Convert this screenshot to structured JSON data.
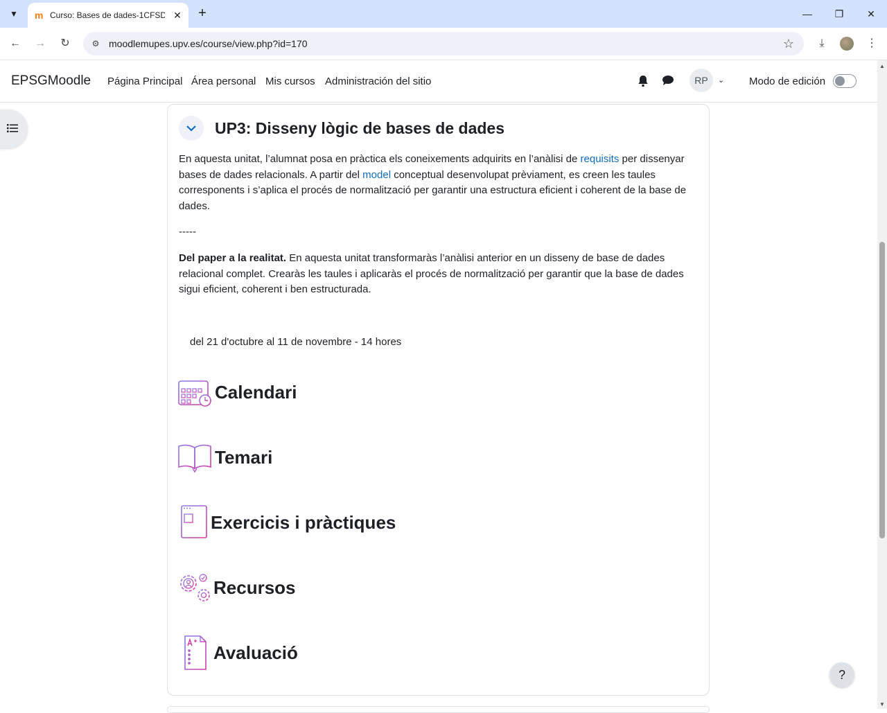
{
  "browser": {
    "tab_title": "Curso: Bases de dades-1CFSDA",
    "favicon": "m",
    "url": "moodlemupes.upv.es/course/view.php?id=170"
  },
  "navbar": {
    "brand": "EPSGMoodle",
    "links": [
      "Página Principal",
      "Área personal",
      "Mis cursos",
      "Administración del sitio"
    ],
    "avatar_initials": "RP",
    "edit_mode_label": "Modo de edición",
    "edit_mode_on": false
  },
  "section": {
    "title": "UP3: Disseny lògic de bases de dades",
    "p1_before_link1": "En aquesta unitat, l’alumnat posa en pràctica els coneixements adquirits en l’anàlisi de ",
    "p1_link1": "requisits",
    "p1_mid": " per dissenyar bases de dades relacionals. A partir del ",
    "p1_link2": "model",
    "p1_after": " conceptual desenvolupat prèviament, es creen les taules corresponents i s’aplica el procés de normalització per garantir una estructura eficient i coherent de la base de dades.",
    "separator": "-----",
    "p2_bold": "Del paper a la realitat.",
    "p2_text": " En aquesta unitat transformaràs l’anàlisi anterior en un disseny de base de dades relacional complet. Crearàs les taules i aplicaràs el procés de normalització per garantir que la base de dades sigui eficient, coherent i ben estructurada.",
    "dates": "del 21 d'octubre al 11 de novembre - 14 hores",
    "blocks": [
      {
        "title": "Calendari",
        "icon": "calendar-clock-icon"
      },
      {
        "title": "Temari",
        "icon": "open-book-icon"
      },
      {
        "title": "Exercicis i pràctiques",
        "icon": "web-page-icon"
      },
      {
        "title": "Recursos",
        "icon": "gears-person-icon"
      },
      {
        "title": "Avaluació",
        "icon": "graded-document-icon"
      }
    ]
  },
  "help_label": "?",
  "colors": {
    "link": "#0f6cbf",
    "tabstrip": "#d3e3fd",
    "icon_gradient_start": "#8a7dea",
    "icon_gradient_end": "#d63aa8"
  }
}
